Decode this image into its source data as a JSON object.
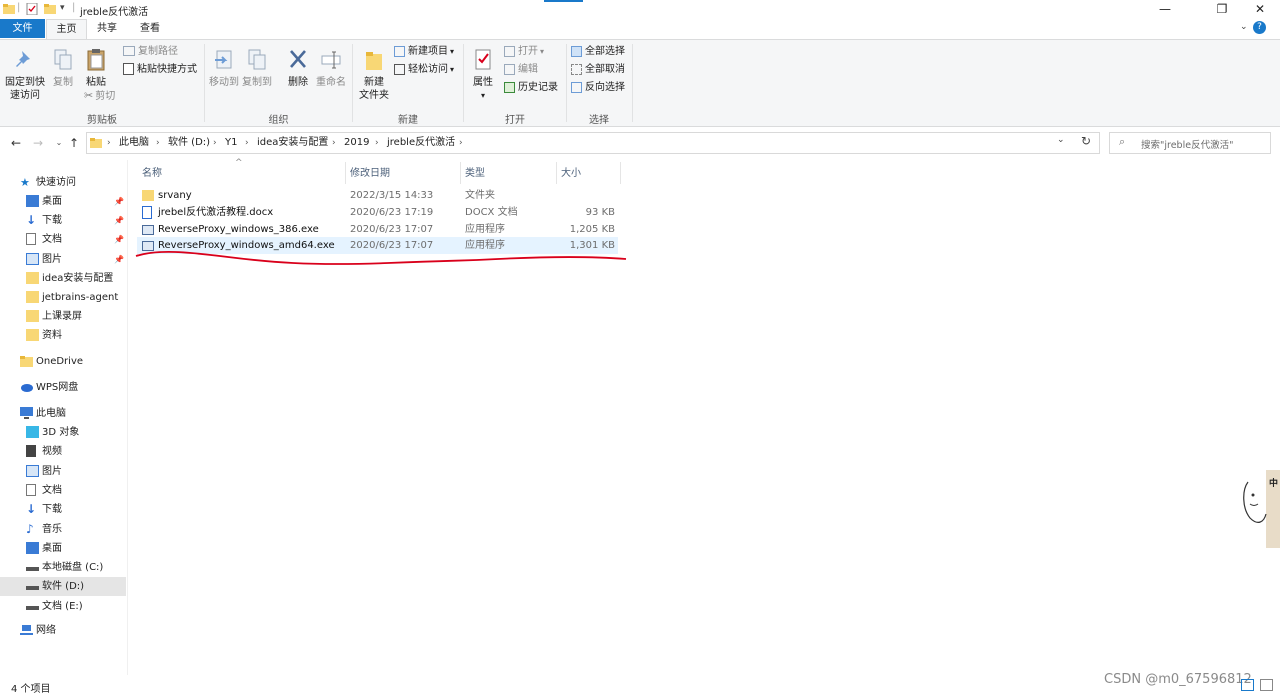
{
  "window": {
    "title": "jreble反代激活",
    "controls": {
      "minimize": "—",
      "restore": "❐",
      "close": "✕"
    }
  },
  "tabs": {
    "file": "文件",
    "home": "主页",
    "share": "共享",
    "view": "查看"
  },
  "help_icon": "?",
  "ribbon": {
    "clipboard": {
      "pin": "固定到快\n速访问",
      "copy": "复制",
      "paste": "粘贴",
      "copy_path": "复制路径",
      "paste_shortcut": "粘贴快捷方式",
      "cut": "剪切",
      "label": "剪贴板"
    },
    "organize": {
      "move_to": "移动到",
      "copy_to": "复制到",
      "delete": "删除",
      "rename": "重命名",
      "label": "组织"
    },
    "new": {
      "new_folder": "新建\n文件夹",
      "new_item": "新建项目",
      "easy_access": "轻松访问",
      "label": "新建"
    },
    "open": {
      "properties": "属性",
      "open": "打开",
      "edit": "编辑",
      "history": "历史记录",
      "label": "打开"
    },
    "select": {
      "select_all": "全部选择",
      "select_none": "全部取消",
      "invert": "反向选择",
      "label": "选择"
    }
  },
  "address": {
    "crumbs": [
      "此电脑",
      "软件 (D:)",
      "Y1",
      "idea安装与配置",
      "2019",
      "jreble反代激活"
    ],
    "search_placeholder": "搜索\"jreble反代激活\""
  },
  "nav": {
    "quick_access": "快速访问",
    "quick_items": [
      {
        "label": "桌面",
        "pinned": true
      },
      {
        "label": "下载",
        "pinned": true
      },
      {
        "label": "文档",
        "pinned": true
      },
      {
        "label": "图片",
        "pinned": true
      },
      {
        "label": "idea安装与配置",
        "pinned": false
      },
      {
        "label": "jetbrains-agent",
        "pinned": false
      },
      {
        "label": "上课录屏",
        "pinned": false
      },
      {
        "label": "资料",
        "pinned": false
      }
    ],
    "onedrive": "OneDrive",
    "wps": "WPS网盘",
    "this_pc": "此电脑",
    "pc_items": [
      "3D 对象",
      "视频",
      "图片",
      "文档",
      "下载",
      "音乐",
      "桌面",
      "本地磁盘 (C:)",
      "软件 (D:)",
      "文档 (E:)"
    ],
    "network": "网络"
  },
  "columns": {
    "name": "名称",
    "date": "修改日期",
    "type": "类型",
    "size": "大小"
  },
  "files": [
    {
      "name": "srvany",
      "date": "2022/3/15 14:33",
      "type": "文件夹",
      "size": "",
      "icon": "folder-icon"
    },
    {
      "name": "jrebel反代激活教程.docx",
      "date": "2020/6/23 17:19",
      "type": "DOCX 文档",
      "size": "93 KB",
      "icon": "docx-icon"
    },
    {
      "name": "ReverseProxy_windows_386.exe",
      "date": "2020/6/23 17:07",
      "type": "应用程序",
      "size": "1,205 KB",
      "icon": "exe-icon"
    },
    {
      "name": "ReverseProxy_windows_amd64.exe",
      "date": "2020/6/23 17:07",
      "type": "应用程序",
      "size": "1,301 KB",
      "icon": "exe-icon"
    }
  ],
  "status": {
    "count": "4 个项目"
  },
  "watermark": "CSDN @m0_67596812",
  "colors": {
    "accent": "#1979ca",
    "selection": "#e5f3ff",
    "annotation": "#d9001b"
  }
}
